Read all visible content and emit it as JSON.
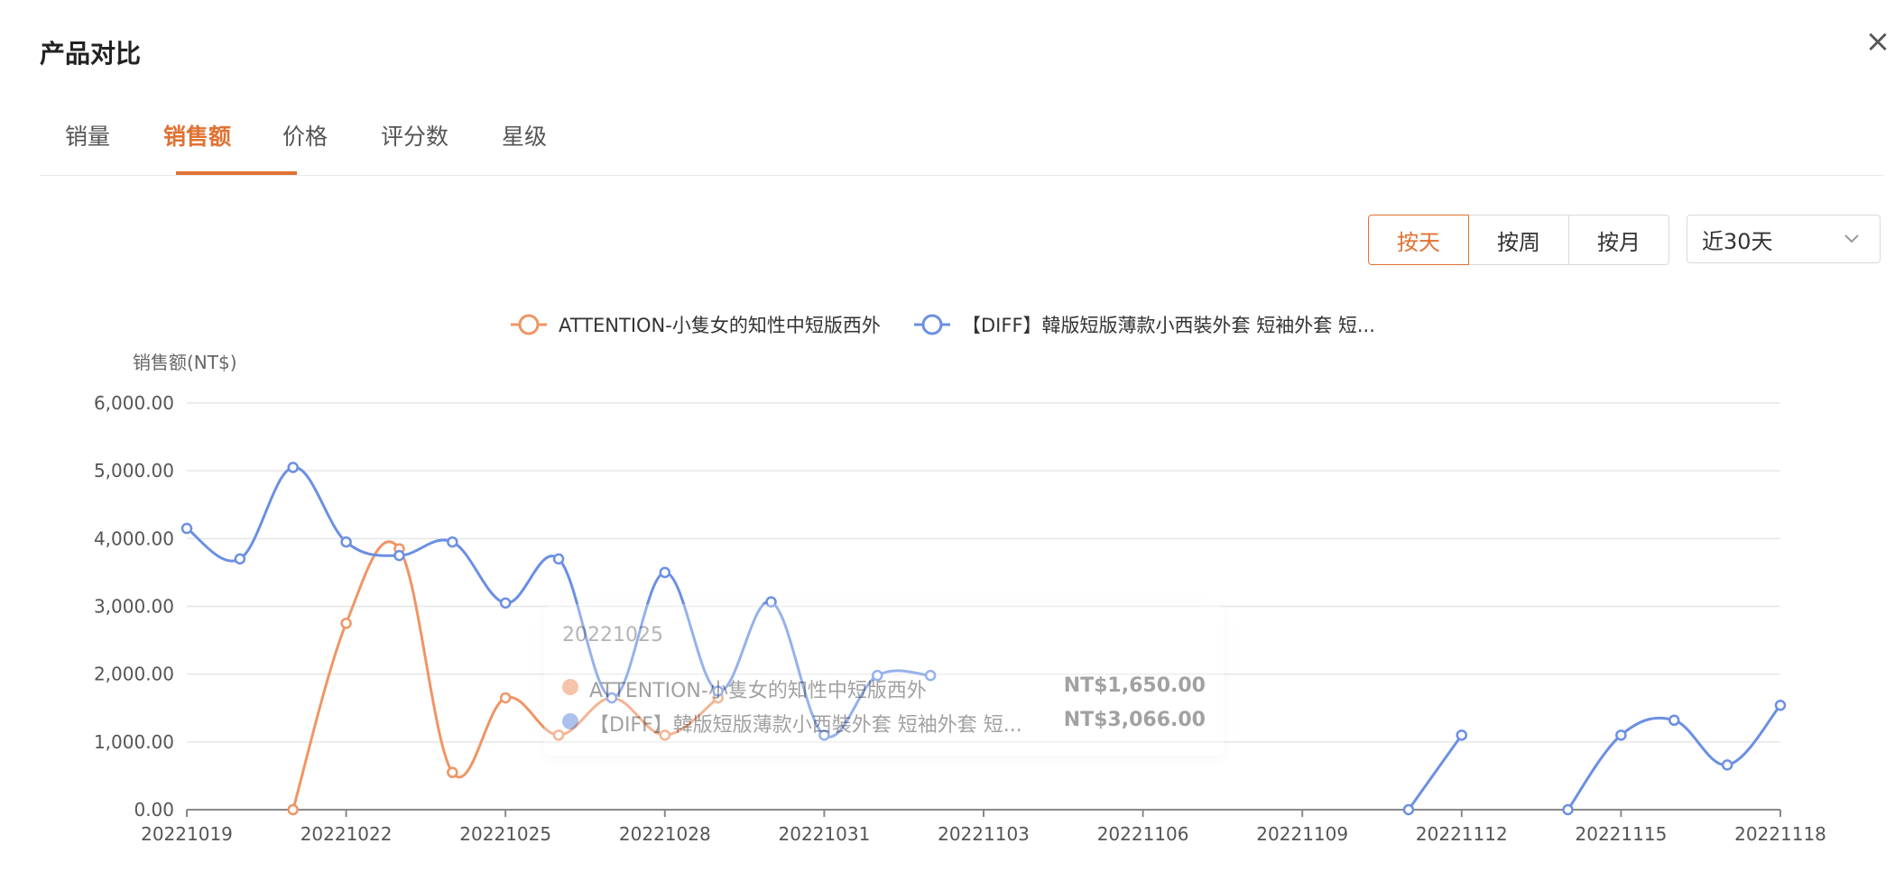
{
  "modal": {
    "title": "产品对比",
    "close": "×"
  },
  "tabs": [
    "销量",
    "销售额",
    "价格",
    "评分数",
    "星级"
  ],
  "active_tab": 1,
  "granularity": {
    "options": [
      "按天",
      "按周",
      "按月"
    ],
    "active": 0
  },
  "range_select": {
    "value": "近30天"
  },
  "colors": {
    "accent": "#e07233",
    "series_a": "#ef9565",
    "series_b": "#6b8fe3"
  },
  "tooltip": {
    "date": "20221025",
    "rows": [
      {
        "name": "ATTENTION-小隻女的知性中短版西外",
        "value": "NT$1,650.00"
      },
      {
        "name": "【DIFF】韓版短版薄款小西裝外套 短袖外套 短...",
        "value": "NT$3,066.00"
      }
    ]
  },
  "chart_data": {
    "type": "line",
    "ylabel": "销售额(NT$)",
    "ylim": [
      0,
      6000
    ],
    "yticks": [
      "0.00",
      "1,000.00",
      "2,000.00",
      "3,000.00",
      "4,000.00",
      "5,000.00",
      "6,000.00"
    ],
    "x": [
      "20221019",
      "20221020",
      "20221021",
      "20221022",
      "20221023",
      "20221024",
      "20221025",
      "20221026",
      "20221027",
      "20221028",
      "20221029",
      "20221030",
      "20221031",
      "20221101",
      "20221102",
      "20221103",
      "20221104",
      "20221105",
      "20221106",
      "20221107",
      "20221108",
      "20221109",
      "20221110",
      "20221111",
      "20221112",
      "20221113",
      "20221114",
      "20221115",
      "20221116",
      "20221117",
      "20221118"
    ],
    "xtick_labels": [
      "20221019",
      "20221022",
      "20221025",
      "20221028",
      "20221031",
      "20221103",
      "20221106",
      "20221109",
      "20221112",
      "20221115",
      "20221118"
    ],
    "grid": true,
    "legend": "top-center",
    "series": [
      {
        "name": "ATTENTION-小隻女的知性中短版西外",
        "values": [
          null,
          null,
          0,
          2750,
          3850,
          550,
          1650,
          1100,
          1650,
          1100,
          1650,
          null,
          null,
          null,
          null,
          null,
          null,
          null,
          null,
          null,
          null,
          null,
          null,
          null,
          null,
          null,
          null,
          null,
          null,
          null,
          null
        ]
      },
      {
        "name": "【DIFF】韓版短版薄款小西裝外套 短袖外套 短...",
        "values": [
          4150,
          3700,
          5050,
          3950,
          3750,
          3950,
          3050,
          3700,
          1650,
          3500,
          1750,
          3066,
          1100,
          1980,
          1980,
          null,
          null,
          null,
          null,
          null,
          null,
          null,
          null,
          0,
          1100,
          null,
          0,
          1100,
          1320,
          660,
          1540
        ]
      }
    ]
  }
}
